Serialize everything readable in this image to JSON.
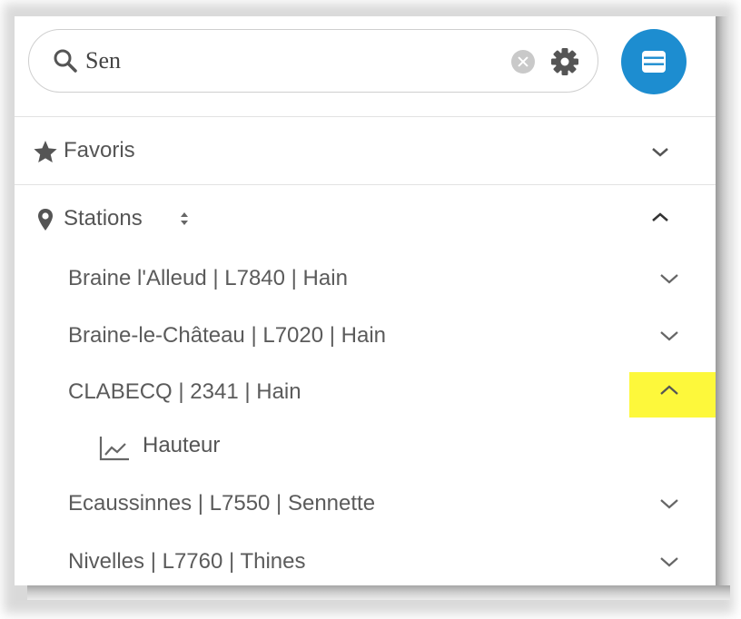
{
  "search": {
    "value": "Sen",
    "icon": "search-icon",
    "clear_icon": "clear-icon",
    "settings_icon": "gear-icon"
  },
  "menu_button": {
    "icon": "list-menu-icon",
    "color": "#1d8dd0"
  },
  "sections": {
    "favorites": {
      "label": "Favoris",
      "icon": "star-icon",
      "expanded": false
    },
    "stations": {
      "label": "Stations",
      "icon": "map-pin-icon",
      "sort_icon": "sort-icon",
      "expanded": true
    }
  },
  "stations": [
    {
      "label": "Braine l'Alleud | L7840 | Hain",
      "expanded": false
    },
    {
      "label": "Braine-le-Château | L7020 | Hain",
      "expanded": false
    },
    {
      "label": "CLABECQ | 2341 | Hain",
      "expanded": true,
      "highlighted": true
    },
    {
      "label": "Ecaussinnes | L7550 | Sennette",
      "expanded": false
    },
    {
      "label": "Nivelles | L7760 | Thines",
      "expanded": false
    }
  ],
  "station_children": {
    "clabecq": [
      {
        "label": "Hauteur",
        "icon": "line-chart-icon"
      }
    ]
  },
  "colors": {
    "accent": "#1d8dd0",
    "highlight": "#fdf83b",
    "text": "#555555"
  }
}
